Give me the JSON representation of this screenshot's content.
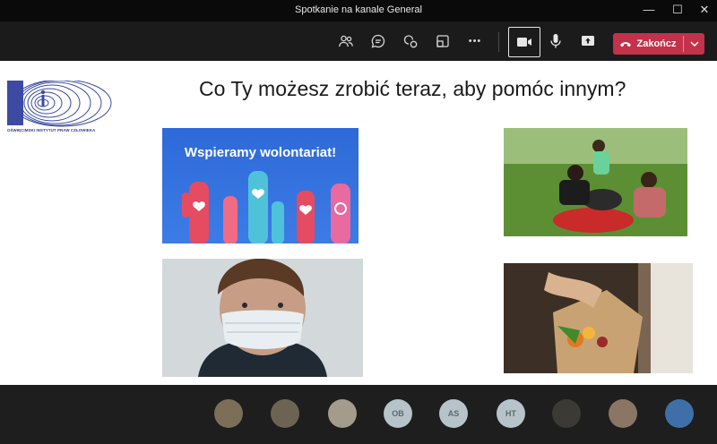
{
  "window": {
    "title": "Spotkanie na kanale General",
    "minimize_glyph": "—",
    "maximize_glyph": "☐",
    "close_glyph": "✕"
  },
  "toolbar": {
    "icons": [
      "participants-icon",
      "chat-icon",
      "reactions-icon",
      "rooms-icon",
      "more-icon",
      "camera-icon",
      "mic-icon",
      "share-icon"
    ],
    "more_glyph": "•••",
    "end_label": "Zakończ",
    "end_color": "#c4314b"
  },
  "slide": {
    "title": "Co Ty możesz zrobić teraz, aby pomóc innym?",
    "logo_text": "OŚWIĘCIMSKI INSTYTUT PRAW CZŁOWIEKA",
    "volunteer_caption": "Wspieramy wolontariat!"
  },
  "participants": [
    {
      "type": "photo",
      "initials": "",
      "color": "#7d6e58"
    },
    {
      "type": "photo",
      "initials": "",
      "color": "#6d6352"
    },
    {
      "type": "photo",
      "initials": "",
      "color": "#a39c8c"
    },
    {
      "type": "initials",
      "initials": "OB",
      "color": "#b6c3c9"
    },
    {
      "type": "initials",
      "initials": "AS",
      "color": "#b6c3c9"
    },
    {
      "type": "initials",
      "initials": "HT",
      "color": "#b6c3c9"
    },
    {
      "type": "photo",
      "initials": "",
      "color": "#3c3a34"
    },
    {
      "type": "photo",
      "initials": "",
      "color": "#8b7564"
    },
    {
      "type": "photo",
      "initials": "",
      "color": "#3f6fa8"
    }
  ]
}
